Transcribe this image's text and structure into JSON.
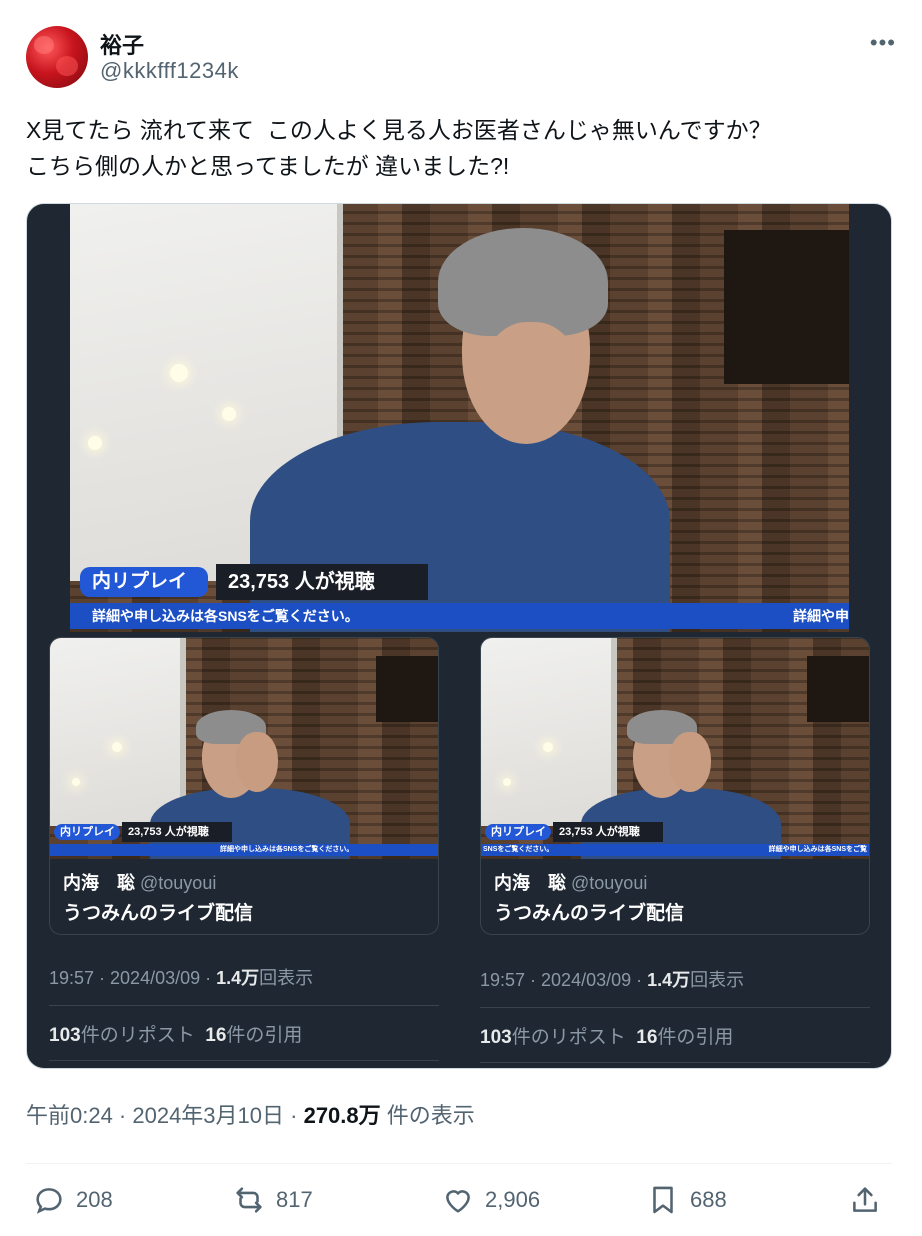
{
  "author": {
    "display_name": "裕子",
    "handle": "@kkkfff1234k"
  },
  "more_label": "•••",
  "tweet_text": "X見てたら 流れて来て  この人よく見る人お医者さんじゃ無いんですか？\nこちら側の人かと思ってましたが 違いました?!",
  "main_video": {
    "replay_label": "内リプレイ",
    "viewer_count": "23,753 人が視聴",
    "banner_text": "詳細や申し込みは各SNSをご覧ください。",
    "banner_right": "詳細や申"
  },
  "cards": [
    {
      "overlay_replay": "内リプレイ",
      "overlay_viewers": "23,753 人が視聴",
      "overlay_banner": "詳細や申し込みは各SNSをご覧ください。",
      "author_name": "内海　聡",
      "author_handle": "@touyoui",
      "title": "うつみんのライブ配信",
      "time_date": "19:57 · 2024/03/09 · ",
      "views_num": "1.4万",
      "views_label": "回表示",
      "reposts_num": "103",
      "reposts_label": "件のリポスト",
      "quotes_num": "16",
      "quotes_label": "件の引用"
    },
    {
      "overlay_replay": "内リプレイ",
      "overlay_viewers": "23,753 人が視聴",
      "overlay_banner": "SNSをご覧ください。",
      "overlay_banner_right": "詳細や申し込みは各SNSをご覧",
      "author_name": "内海　聡",
      "author_handle": "@touyoui",
      "title": "うつみんのライブ配信",
      "time_date": "19:57 · 2024/03/09 · ",
      "views_num": "1.4万",
      "views_label": "回表示",
      "reposts_num": "103",
      "reposts_label": "件のリポスト",
      "quotes_num": "16",
      "quotes_label": "件の引用"
    }
  ],
  "post_meta": {
    "time": "午前0:24 · 2024年3月10日 · ",
    "views_num": "270.8万",
    "views_label": " 件の表示"
  },
  "actions": {
    "replies": "208",
    "reposts": "817",
    "likes": "2,906",
    "bookmarks": "688"
  },
  "icons": [
    "reply-icon",
    "repost-icon",
    "like-icon",
    "bookmark-icon",
    "share-icon"
  ],
  "colors": {
    "accent_blue": "#1d4fc4",
    "text_secondary": "#536471",
    "media_bg": "#1e2732"
  }
}
